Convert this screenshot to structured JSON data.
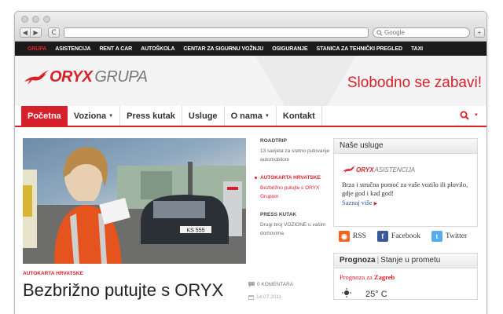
{
  "browser": {
    "search_placeholder": "Google",
    "back": "◀",
    "forward": "▶",
    "reload": "C",
    "add": "+"
  },
  "topmenu": [
    {
      "label": "GRUPA",
      "active": true
    },
    {
      "label": "ASISTENCIJA"
    },
    {
      "label": "RENT A CAR"
    },
    {
      "label": "AUTOŠKOLA"
    },
    {
      "label": "CENTAR ZA SIGURNU VOŽNJU"
    },
    {
      "label": "OSIGURANJE"
    },
    {
      "label": "STANICA ZA TEHNIČKI PREGLED"
    },
    {
      "label": "TAXI"
    }
  ],
  "header": {
    "logo_main": "ORYX",
    "logo_sub": "GRUPA",
    "slogan": "Slobodno se zabavi!"
  },
  "mainnav": {
    "items": [
      "Početna",
      "Voziona",
      "Press kutak",
      "Usluge",
      "O nama",
      "Kontakt"
    ],
    "caret": "▼"
  },
  "hero": {
    "plate": "KS 555"
  },
  "side_articles": [
    {
      "category": "ROADTRIP",
      "text": "13 savjeta za sretno putovanje automobilom"
    },
    {
      "category": "AUTOKARTA HRVATSKE",
      "text": "Bezbrižno putujte s ORYX Grupom"
    },
    {
      "category": "PRESS KUTAK",
      "text": "Drugi broj VOZIONE u vašim domovima"
    }
  ],
  "usluge": {
    "heading": "Naše usluge",
    "logo_main": "ORYX",
    "logo_sub": "ASISTENCIJA",
    "text": "Brza i stručna pomoć za vaše vozilo ili plovilo, gdje god i kad god!",
    "link": "Saznaj više",
    "link_arrow": "▶"
  },
  "social": [
    {
      "label": "RSS",
      "icon": "rss-icon",
      "color": "#f26522",
      "glyph": "◉"
    },
    {
      "label": "Facebook",
      "icon": "facebook-icon",
      "color": "#3b5998",
      "glyph": "f"
    },
    {
      "label": "Twitter",
      "icon": "twitter-icon",
      "color": "#55acee",
      "glyph": "t"
    }
  ],
  "prognoza": {
    "tab_active": "Prognoza",
    "separator": "|",
    "tab_other": "Stanje u prometu",
    "location_prefix": "Prognoza za",
    "location": "Zagreb",
    "temperature": "25° C"
  },
  "article": {
    "category": "AUTOKARTA HRVATSKE",
    "title": "Bezbrižno putujte s ORYX",
    "comments": "0 KOMENTARA",
    "date": "14.07.2011"
  },
  "colors": {
    "brand_red": "#d8202a",
    "top_menu_bg": "#1b1b1b",
    "link_blue": "#2d5a9e"
  }
}
